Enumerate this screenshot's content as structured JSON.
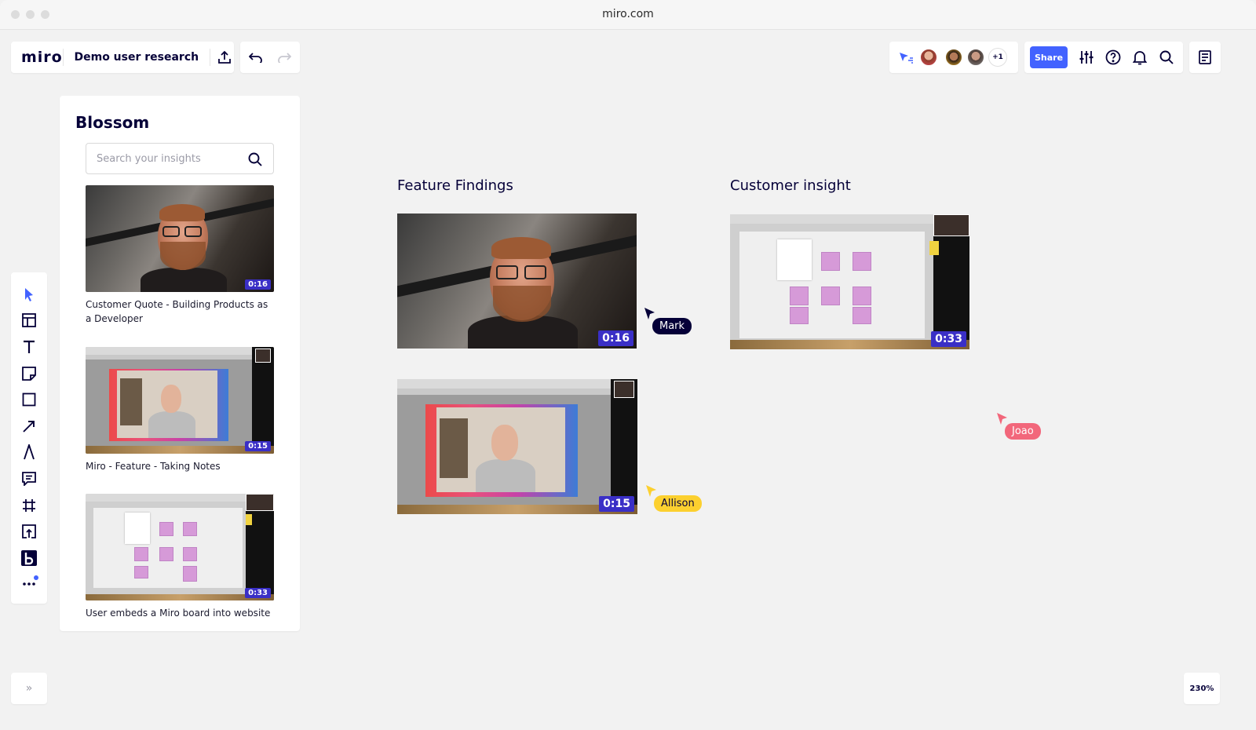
{
  "browser": {
    "url": "miro.com"
  },
  "header": {
    "logo": "miro",
    "board_title": "Demo user research",
    "share_label": "Share",
    "extra_collaborators": "+1"
  },
  "icons": {
    "export": "export-icon",
    "undo": "undo-icon",
    "redo": "redo-icon",
    "follow": "cursor-follow-icon",
    "settings": "settings-sliders-icon",
    "help": "help-icon",
    "notifications": "bell-icon",
    "search": "search-icon",
    "notes": "notes-icon"
  },
  "colors": {
    "accent": "#4262ff",
    "duration_badge": "#3a2fc6",
    "mark": "#050038",
    "allison": "#fcd02f",
    "joao": "#f2677b"
  },
  "toolbar": {
    "tools": [
      "select",
      "templates",
      "text",
      "sticky-note",
      "shape",
      "connection-line",
      "pen",
      "comment",
      "frame",
      "upload",
      "blossom-app",
      "more"
    ]
  },
  "blossom": {
    "title": "Blossom",
    "search_placeholder": "Search your insights",
    "items": [
      {
        "caption": "Customer Quote - Building Products as a Developer",
        "duration": "0:16"
      },
      {
        "caption": "Miro - Feature - Taking Notes",
        "duration": "0:15"
      },
      {
        "caption": "User embeds a Miro board into website",
        "duration": "0:33"
      }
    ]
  },
  "canvas": {
    "frames": [
      {
        "title": "Feature Findings",
        "videos": [
          {
            "duration": "0:16"
          },
          {
            "duration": "0:15"
          }
        ]
      },
      {
        "title": "Customer insight",
        "videos": [
          {
            "duration": "0:33"
          }
        ]
      }
    ],
    "cursors": [
      {
        "name": "Mark",
        "color": "#050038"
      },
      {
        "name": "Allison",
        "color": "#fcd02f"
      },
      {
        "name": "Joao",
        "color": "#f2677b"
      }
    ]
  },
  "footer": {
    "expand_label": "»",
    "zoom": "230%"
  }
}
